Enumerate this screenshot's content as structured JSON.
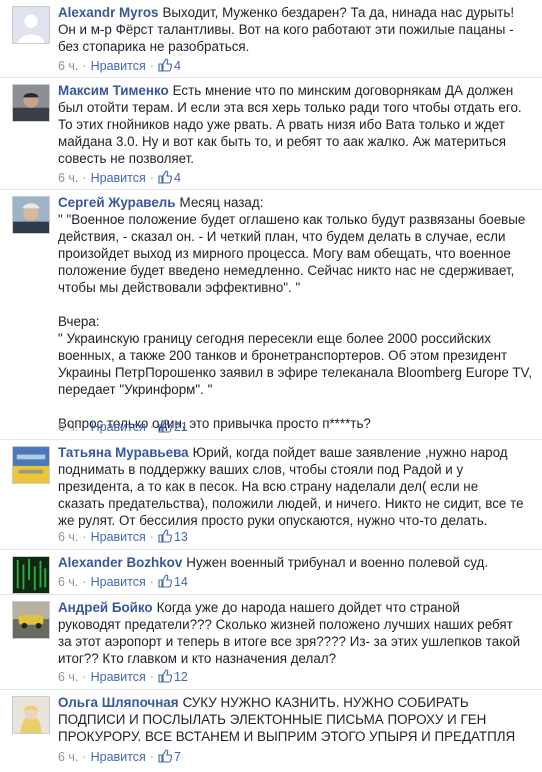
{
  "ui": {
    "like_label": "Нравится",
    "separator": "·"
  },
  "comments": [
    {
      "author": "Alexandr Myros",
      "text": "Выходит, Муженко бездарен? Та да, нинада нас дурыть!\nОн и м-р Фёрст талантливы. Вот на кого работают эти пожилые пацаны -\nбез стопарика не разобраться.",
      "time": "6 ч.",
      "likes": "4"
    },
    {
      "author": "Максим Тименко",
      "text": "Есть мнение что по минским договорнякам ДА должен\nбыл отойти терам. И если эта вся херь только ради того чтобы отдать его.\nТо этих гнойников надо уже рвать. А рвать низя ибо Вата только и ждет\nмайдана 3.0. Ну и вот как быть то, и ребят то аак жалко. Аж материться\nсовесть не позволяет.",
      "time": "6 ч.",
      "likes": "4"
    },
    {
      "author": "Сергей Журавель",
      "text": "Месяц назад:\n\" \"Военное положение будет оглашено как только будут развязаны боевые\nдействия, - сказал он. - И четкий план, что будем делать в случае, если\nпроизойдет выход из мирного процесса. Могу вам обещать, что военное\nположение будет введено немедленно. Сейчас никто нас не сдерживает,\nчтобы мы действовали эффективно\". \"\n\nВчера:\n\" Украинскую границу сегодня пересекли еще более 2000 российских\nвоенных, а также 200 танков и бронетранспортеров. Об этом президент\nУкраины ПетрПорошенко заявил в эфире телеканала Bloomberg Europe TV,\nпередает \"Укринформ\". \"\n\nВопрос только один, это привычка просто п****ть?",
      "time": "6 ч.",
      "likes": "21"
    },
    {
      "author": "Татьяна Муравьева",
      "text": "Юрий, когда пойдет ваше заявление ,нужно народ\nподнимать в поддержку ваших слов, чтобы стояли под Радой и у\nпрезидента, а то как в песок. На всю страну наделали дел( если не\nсказать предательства), положили людей, и ничего. Никто не сидит, все те\nже рулят. От бессилия просто руки опускаются, нужно что-то делать.",
      "time": "6 ч.",
      "likes": "13"
    },
    {
      "author": "Alexander Bozhkov",
      "text": "Нужен военный трибунал и военно полевой суд.",
      "time": "6 ч.",
      "likes": "14"
    },
    {
      "author": "Андрей Бойко",
      "text": "Когда уже до народа нашего дойдет что страной\nруководят предатели??? Сколько жизней положено лучших наших ребят\nза этот аэропорт и теперь в итоге все зря???? Из- за этих ушлепков такой\nитог?? Кто главком и кто назначения делал?",
      "time": "6 ч.",
      "likes": "12"
    },
    {
      "author": "Ольга Шляпочная",
      "text": "СУКУ НУЖНО КАЗНИТЬ. НУЖНО СОБИРАТЬ\nПОДПИСИ И ПОСЛЫЛАТЬ ЭЛЕКТОННЫЕ ПИСЬМА ПОРОХУ И ГЕН\nПРОКУРОРУ. ВСЕ ВСТАНЕМ И ВЫПРИМ ЭТОГО УПЫРЯ И ПРЕДАТПЛЯ",
      "time": "6 ч.",
      "likes": "7"
    }
  ],
  "colors": {
    "author": "#365899",
    "link": "#4267b2",
    "meta": "#90949c",
    "text": "#1d2129"
  }
}
